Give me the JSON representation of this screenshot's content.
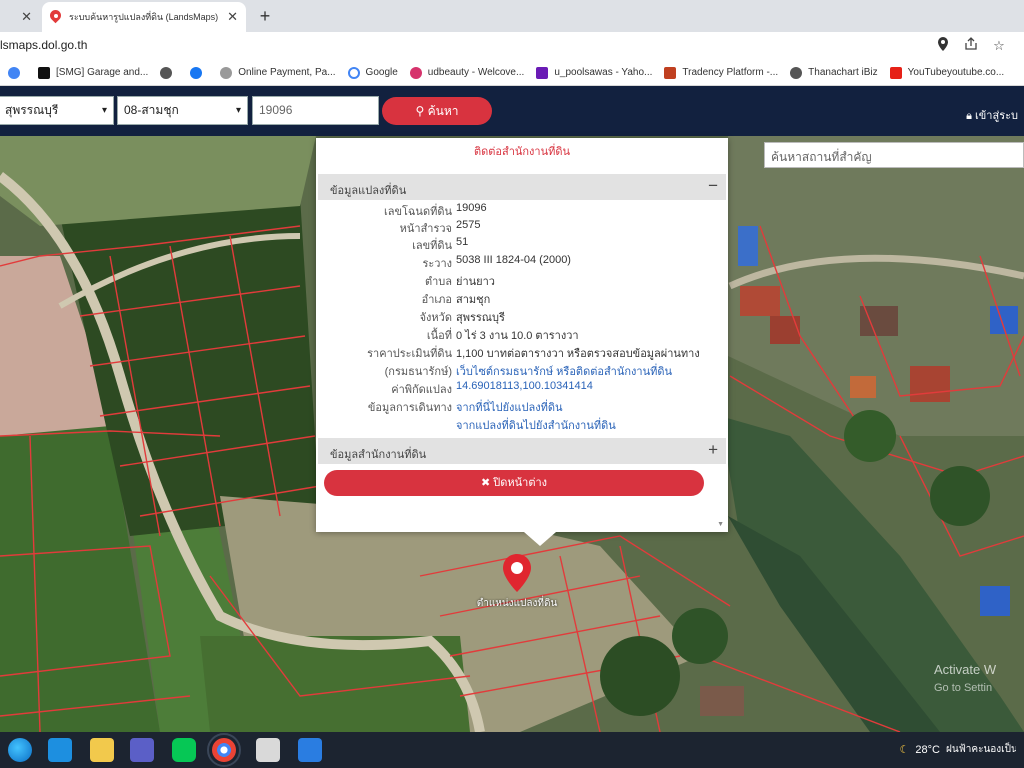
{
  "browser": {
    "tabs": [
      {
        "label": "",
        "active": false
      },
      {
        "label": "ระบบค้นหารูปแปลงที่ดิน (LandsMaps)",
        "active": true
      }
    ],
    "url": "lsmaps.dol.go.th",
    "bookmarks": [
      {
        "label": "[SMG] Garage and...",
        "color": "#111111"
      },
      {
        "label": "",
        "color": "#555555"
      },
      {
        "label": "",
        "color": "#1877f2"
      },
      {
        "label": "Online Payment, Pa...",
        "color": "#888888"
      },
      {
        "label": "Google",
        "color": "#888888"
      },
      {
        "label": "udbeauty - Welcove...",
        "color": "#d6336c"
      },
      {
        "label": "u_poolsawas - Yaho...",
        "color": "#6a1bb5"
      },
      {
        "label": "Tradency Platform -...",
        "color": "#c04020"
      },
      {
        "label": "Thanachart iBiz",
        "color": "#555555"
      },
      {
        "label": "YouTubeyoutube.co...",
        "color": "#e62117"
      }
    ]
  },
  "site": {
    "province": "สุพรรณบุรี",
    "district": "08-สามชุก",
    "parcel_input": "19096",
    "search_label": "ค้นหา",
    "login_label": "เข้าสู่ระบ"
  },
  "map": {
    "place_search_placeholder": "ค้นหาสถานที่สำคัญ",
    "marker_label": "ตำแหน่งแปลงที่ดิน",
    "watermark_line1": "Activate W",
    "watermark_line2": "Go to Settin"
  },
  "popup": {
    "contact_link": "ติดต่อสำนักงานที่ดิน",
    "section1_title": "ข้อมูลแปลงที่ดิน",
    "section1_toggle": "−",
    "section2_title": "ข้อมูลสำนักงานที่ดิน",
    "section2_toggle": "+",
    "rows": [
      {
        "label": "เลขโฉนดที่ดิน",
        "value": "19096"
      },
      {
        "label": "หน้าสำรวจ",
        "value": "2575"
      },
      {
        "label": "เลขที่ดิน",
        "value": "51"
      },
      {
        "label": "ระวาง",
        "value": "5038 III 1824-04 (2000)"
      },
      {
        "label": "ตำบล",
        "value": "ย่านยาว"
      },
      {
        "label": "อำเภอ",
        "value": "สามชุก"
      },
      {
        "label": "จังหวัด",
        "value": "สุพรรณบุรี"
      },
      {
        "label": "เนื้อที่",
        "value": "0 ไร่ 3 งาน 10.0 ตารางวา"
      },
      {
        "label": "ราคาประเมินที่ดิน",
        "value": "1,100 บาทต่อตารางวา หรือตรวจสอบข้อมูลผ่านทาง"
      },
      {
        "label": "(กรมธนารักษ์)",
        "value": "เว็บไซต์กรมธนารักษ์ หรือติดต่อสำนักงานที่ดิน"
      },
      {
        "label": "ค่าพิกัดแปลง",
        "value": "14.69018113,100.10341414"
      },
      {
        "label": "ข้อมูลการเดินทาง",
        "value": "จากที่นี่ไปยังแปลงที่ดิน"
      },
      {
        "label": "",
        "value": "จากแปลงที่ดินไปยังสำนักงานที่ดิน"
      }
    ],
    "close_label": "✖ ปิดหน้าต่าง"
  },
  "taskbar": {
    "temperature": "28°C",
    "weather": "ฝนฟ้าคะนองเป็นบางแห่ง"
  }
}
